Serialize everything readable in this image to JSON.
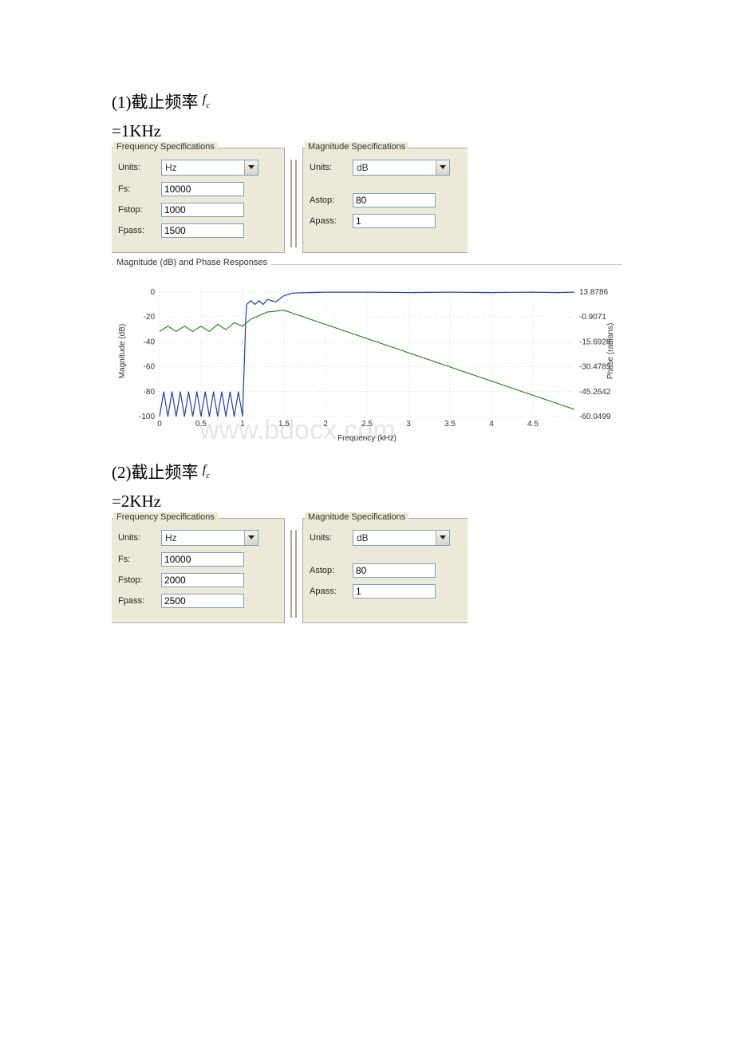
{
  "section1": {
    "heading_prefix": "(1)截止频率",
    "heading_symbol_base": "f",
    "heading_symbol_sub": "c",
    "subheading": "=1KHz"
  },
  "section2": {
    "heading_prefix": "(2)截止频率",
    "heading_symbol_base": "f",
    "heading_symbol_sub": "c",
    "subheading": "=2KHz"
  },
  "freqspec1": {
    "legend": "Frequency Specifications",
    "units_label": "Units:",
    "units_value": "Hz",
    "fs_label": "Fs:",
    "fs_value": "10000",
    "fstop_label": "Fstop:",
    "fstop_value": "1000",
    "fpass_label": "Fpass:",
    "fpass_value": "1500"
  },
  "magspec1": {
    "legend": "Magnitude Specifications",
    "units_label": "Units:",
    "units_value": "dB",
    "astop_label": "Astop:",
    "astop_value": "80",
    "apass_label": "Apass:",
    "apass_value": "1"
  },
  "freqspec2": {
    "legend": "Frequency Specifications",
    "units_label": "Units:",
    "units_value": "Hz",
    "fs_label": "Fs:",
    "fs_value": "10000",
    "fstop_label": "Fstop:",
    "fstop_value": "2000",
    "fpass_label": "Fpass:",
    "fpass_value": "2500"
  },
  "magspec2": {
    "legend": "Magnitude Specifications",
    "units_label": "Units:",
    "units_value": "dB",
    "astop_label": "Astop:",
    "astop_value": "80",
    "apass_label": "Apass:",
    "apass_value": "1"
  },
  "response_panel_legend": "Magnitude (dB) and Phase Responses",
  "watermark": "www.bdocx.com",
  "chart_data": {
    "type": "line",
    "title": "",
    "xlabel": "Frequency (kHz)",
    "ylabel_left": "Magnitude (dB)",
    "ylabel_right": "Phase (radians)",
    "x_ticks": [
      0,
      0.5,
      1,
      1.5,
      2,
      2.5,
      3,
      3.5,
      4,
      4.5
    ],
    "xlim": [
      0,
      5
    ],
    "y_left_ticks": [
      0,
      -20,
      -40,
      -60,
      -80,
      -100
    ],
    "ylim_left": [
      -100,
      5
    ],
    "y_right_ticks": [
      13.8786,
      -0.9071,
      -15.6928,
      -30.4785,
      -45.2642,
      -60.0499
    ],
    "ylim_right": [
      -60.05,
      13.88
    ],
    "series": [
      {
        "name": "Magnitude (dB)",
        "color": "#1e40b4",
        "axis": "left",
        "x": [
          0,
          0.05,
          0.1,
          0.15,
          0.2,
          0.25,
          0.3,
          0.35,
          0.4,
          0.45,
          0.5,
          0.55,
          0.6,
          0.65,
          0.7,
          0.75,
          0.8,
          0.85,
          0.9,
          0.95,
          1.0,
          1.01,
          1.02,
          1.03,
          1.04,
          1.05,
          1.1,
          1.15,
          1.2,
          1.25,
          1.3,
          1.4,
          1.5,
          1.6,
          1.8,
          2.0,
          2.5,
          3.0,
          3.5,
          4.0,
          4.5,
          4.8,
          5.0
        ],
        "y": [
          -100,
          -80,
          -100,
          -80,
          -100,
          -80,
          -100,
          -80,
          -100,
          -80,
          -100,
          -80,
          -100,
          -80,
          -100,
          -80,
          -100,
          -80,
          -100,
          -80,
          -100,
          -80,
          -60,
          -40,
          -20,
          -10,
          -7,
          -10,
          -7,
          -10,
          -6,
          -8,
          -3,
          -1,
          -0.5,
          -0.2,
          -0.2,
          -0.5,
          -0.2,
          -0.5,
          -0.2,
          -0.5,
          -0.2
        ]
      },
      {
        "name": "Phase (radians)",
        "color": "#2c8a2c",
        "axis": "right",
        "x": [
          0,
          0.1,
          0.2,
          0.3,
          0.4,
          0.5,
          0.6,
          0.7,
          0.8,
          0.9,
          1.0,
          1.1,
          1.2,
          1.3,
          1.5,
          2.0,
          2.5,
          3.0,
          3.5,
          4.0,
          4.5,
          5.0
        ],
        "y": [
          -12,
          -9,
          -12,
          -9,
          -12,
          -9,
          -12,
          -8,
          -11,
          -7,
          -9,
          -5,
          -3,
          -1,
          0,
          -8,
          -16,
          -24,
          -32,
          -40,
          -48,
          -56
        ]
      }
    ]
  }
}
